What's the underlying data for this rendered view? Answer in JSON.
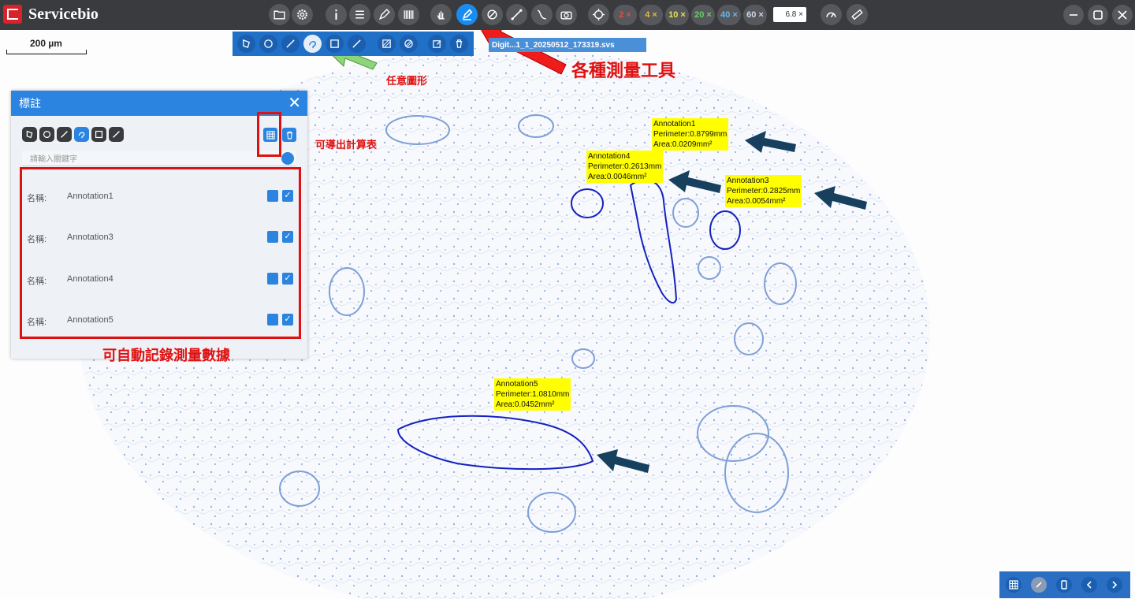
{
  "app": {
    "brand": "Servicebio"
  },
  "zoom": {
    "levels": [
      {
        "label": "2 ×",
        "color": "#e0504a"
      },
      {
        "label": "4 ×",
        "color": "#e8b840"
      },
      {
        "label": "10 ×",
        "color": "#e8e050"
      },
      {
        "label": "20 ×",
        "color": "#6ad06a"
      },
      {
        "label": "40 ×",
        "color": "#6ab6f0"
      },
      {
        "label": "60 ×",
        "color": "#cfd6e6"
      }
    ],
    "current": "6.8 ×"
  },
  "scale": {
    "label": "200 µm"
  },
  "file_tab": "Digit...1_1_20250512_173319.svs",
  "panel": {
    "title": "標註",
    "close_label": "✕",
    "search_placeholder": "請輸入關鍵字",
    "rows": [
      {
        "label": "名稱:",
        "value": "Annotation1"
      },
      {
        "label": "名稱:",
        "value": "Annotation3"
      },
      {
        "label": "名稱:",
        "value": "Annotation4"
      },
      {
        "label": "名稱:",
        "value": "Annotation5"
      }
    ],
    "check_mark": "✓"
  },
  "callouts": {
    "tools": "各種測量工具",
    "freehand": "任意圖形",
    "export": "可導出計算表",
    "record": "可自動記錄測量數據"
  },
  "annotations": [
    {
      "name": "Annotation1",
      "perimeter": "Perimeter:0.8799mm",
      "area": "Area:0.0209mm²"
    },
    {
      "name": "Annotation4",
      "perimeter": "Perimeter:0.2613mm",
      "area": "Area:0.0046mm²"
    },
    {
      "name": "Annotation3",
      "perimeter": "Perimeter:0.2825mm",
      "area": "Area:0.0054mm²"
    },
    {
      "name": "Annotation5",
      "perimeter": "Perimeter:1.0810mm",
      "area": "Area:0.0452mm²"
    }
  ],
  "colors": {
    "topbar": "#3a3b3e",
    "accent": "#2b84e0",
    "highlight": "#ffff00",
    "callout": "#e01010",
    "outline": "#1520c0",
    "arrow": "#17405e"
  }
}
